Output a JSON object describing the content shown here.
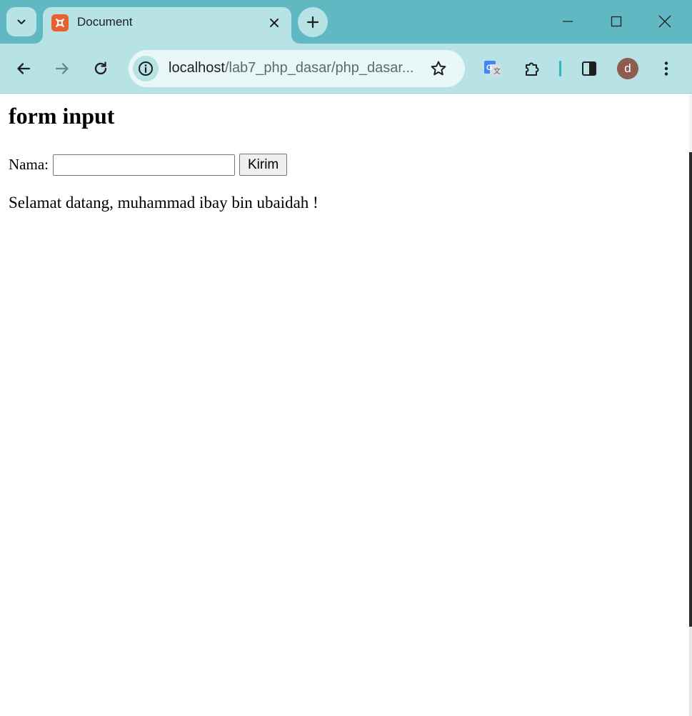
{
  "browser": {
    "tab": {
      "title": "Document",
      "favicon": "xampp-icon"
    },
    "address_bar": {
      "host": "localhost",
      "path": "/lab7_php_dasar/php_dasar..."
    },
    "profile_initial": "d",
    "colors": {
      "frame": "#5fb8c2",
      "toolbar": "#b7e2e6",
      "omnibox": "#eaf7f8",
      "favicon": "#e8622e",
      "avatar": "#8d5d52"
    },
    "icons": {
      "tab_search": "chevron-down-icon",
      "tab_close": "close-icon",
      "new_tab": "plus-icon",
      "minimize": "minimize-icon",
      "maximize": "maximize-icon",
      "close_window": "close-icon",
      "back": "arrow-left-icon",
      "forward": "arrow-right-icon",
      "reload": "reload-icon",
      "site_info": "info-icon",
      "bookmark": "star-icon",
      "translate": "google-translate-icon",
      "extensions": "puzzle-icon",
      "side_panel": "side-panel-icon",
      "menu": "kebab-menu-icon"
    }
  },
  "page": {
    "heading": "form input",
    "form": {
      "label": "Nama:",
      "input_value": "",
      "submit_label": "Kirim"
    },
    "greeting": "Selamat datang, muhammad ibay bin ubaidah !"
  }
}
